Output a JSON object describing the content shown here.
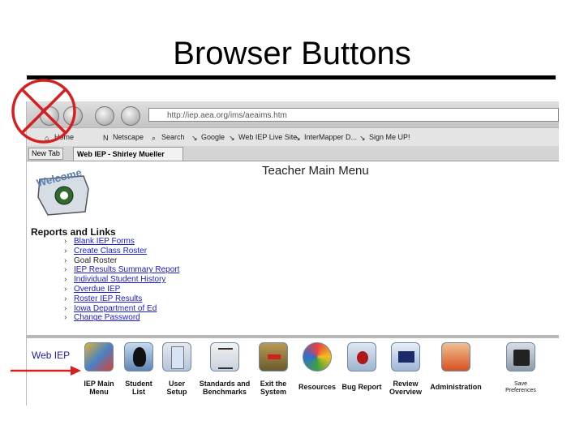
{
  "slide": {
    "title": "Browser Buttons"
  },
  "browser": {
    "url": "http://iep.aea.org/ims/aeaims.htm",
    "bookmarks": [
      "Home",
      "Netscape",
      "Search",
      "Google",
      "Web IEP Live Site",
      "InterMapper D...",
      "Sign Me UP!"
    ],
    "tabs": {
      "new_tab": "New Tab",
      "active": "Web IEP - Shirley Mueller"
    }
  },
  "page": {
    "main_title": "Teacher Main Menu",
    "reports_heading": "Reports and Links",
    "links": [
      "Blank IEP Forms",
      "Create Class Roster",
      "Goal Roster",
      "IEP Results Summary Report",
      "Individual Student History",
      "Overdue IEP",
      "Roster IEP Results",
      "Iowa Department of Ed",
      "Change Password"
    ],
    "plain_links": [
      "Goal Roster"
    ],
    "webiep_label": "Web IEP",
    "toolbar": [
      {
        "label": "IEP Main\nMenu",
        "icon": "iep-main-menu-icon"
      },
      {
        "label": "Student\nList",
        "icon": "student-list-icon"
      },
      {
        "label": "User\nSetup",
        "icon": "user-setup-icon"
      },
      {
        "label": "Standards and\nBenchmarks",
        "icon": "standards-icon"
      },
      {
        "label": "Exit the\nSystem",
        "icon": "exit-icon"
      },
      {
        "label": "Resources",
        "icon": "resources-icon"
      },
      {
        "label": "Bug Report",
        "icon": "bug-report-icon"
      },
      {
        "label": "Review\nOverview",
        "icon": "review-overview-icon"
      },
      {
        "label": "Administration",
        "icon": "administration-icon"
      },
      {
        "label": "Save\nPreferences",
        "icon": "save-preferences-icon"
      }
    ]
  },
  "colors": {
    "annotation_red": "#d42020",
    "link_blue": "#1a1ad0"
  }
}
